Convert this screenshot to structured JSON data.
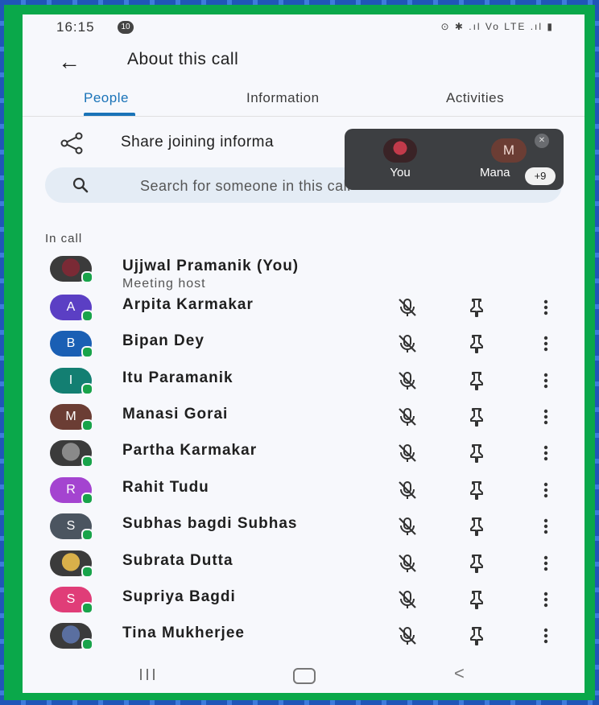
{
  "status_bar": {
    "time": "16:15",
    "notification_count": "10",
    "icons_text": "⊙ ✱ .ıl Vo LTE .ıl ▮"
  },
  "header": {
    "title": "About this call"
  },
  "tabs": [
    {
      "label": "People",
      "active": true
    },
    {
      "label": "Information",
      "active": false
    },
    {
      "label": "Activities",
      "active": false
    }
  ],
  "share": {
    "label": "Share joining informa"
  },
  "search": {
    "placeholder": "Search for someone in this call"
  },
  "overlay": {
    "you_label": "You",
    "second_initial": "M",
    "second_label": "Mana",
    "more_badge": "+9"
  },
  "section": {
    "label": "In call"
  },
  "participants": [
    {
      "name": "Ujjwal Pramanik (You)",
      "subtitle": "Meeting host",
      "initial": "",
      "color": "#7a2a35",
      "photo": true
    },
    {
      "name": "Arpita Karmakar",
      "initial": "A",
      "color": "#5b3fc4"
    },
    {
      "name": "Bipan Dey",
      "initial": "B",
      "color": "#1a5fb4"
    },
    {
      "name": "Itu Paramanik",
      "initial": "I",
      "color": "#137f72"
    },
    {
      "name": "Manasi Gorai",
      "initial": "M",
      "color": "#6b3d34"
    },
    {
      "name": "Partha Karmakar",
      "initial": "",
      "color": "#8a8a8a",
      "photo": true
    },
    {
      "name": "Rahit Tudu",
      "initial": "R",
      "color": "#a444d0"
    },
    {
      "name": "Subhas bagdi Subhas",
      "initial": "S",
      "color": "#4b5560"
    },
    {
      "name": "Subrata Dutta",
      "initial": "",
      "color": "#d9b04a",
      "photo": true
    },
    {
      "name": "Supriya Bagdi",
      "initial": "S",
      "color": "#e03d78"
    },
    {
      "name": "Tina Mukherjee",
      "initial": "",
      "color": "#5a6fa0",
      "photo": true
    }
  ],
  "colors": {
    "accent": "#1a73b8",
    "online": "#18a34a",
    "frame": "#0aa84a"
  }
}
